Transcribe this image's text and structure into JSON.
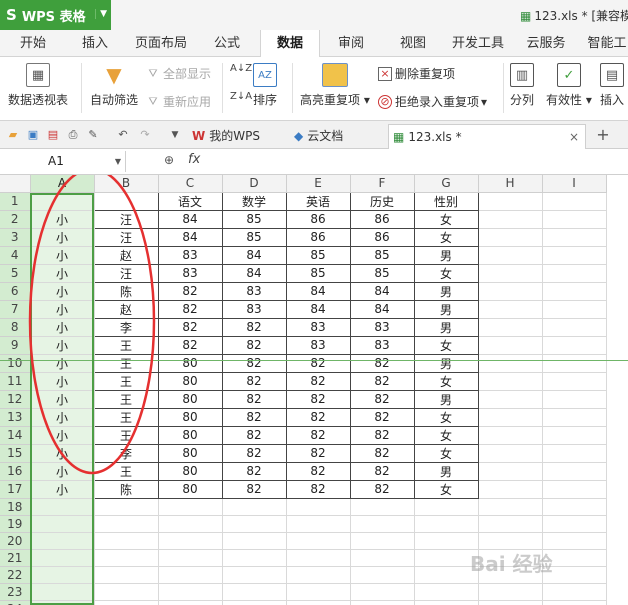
{
  "titlebar": {
    "app_name": "WPS 表格",
    "doc_title": "123.xls * [兼容模"
  },
  "menu": {
    "tabs": [
      "开始",
      "插入",
      "页面布局",
      "公式",
      "数据",
      "审阅",
      "视图",
      "开发工具",
      "云服务",
      "智能工"
    ],
    "active": "数据"
  },
  "ribbon": {
    "pivot": "数据透视表",
    "autofilter": "自动筛选",
    "show_all": "全部显示",
    "reapply": "重新应用",
    "sort": "排序",
    "highlight_dup": "高亮重复项",
    "remove_dup": "删除重复项",
    "reject_dup": "拒绝录入重复项",
    "split": "分列",
    "validity": "有效性",
    "insert": "插入"
  },
  "tabstrip": {
    "tabs": [
      {
        "label": "我的WPS"
      },
      {
        "label": "云文档"
      },
      {
        "label": "123.xls *"
      }
    ]
  },
  "formula": {
    "cell": "A1",
    "fx": "fx"
  },
  "grid": {
    "columns": [
      "A",
      "B",
      "C",
      "D",
      "E",
      "F",
      "G",
      "H",
      "I"
    ],
    "header_row": [
      "",
      "",
      "语文",
      "数学",
      "英语",
      "历史",
      "性别"
    ],
    "rows": [
      [
        "小",
        "汪",
        "84",
        "85",
        "86",
        "86",
        "女"
      ],
      [
        "小",
        "汪",
        "84",
        "85",
        "86",
        "86",
        "女"
      ],
      [
        "小",
        "赵",
        "83",
        "84",
        "85",
        "85",
        "男"
      ],
      [
        "小",
        "汪",
        "83",
        "84",
        "85",
        "85",
        "女"
      ],
      [
        "小",
        "陈",
        "82",
        "83",
        "84",
        "84",
        "男"
      ],
      [
        "小",
        "赵",
        "82",
        "83",
        "84",
        "84",
        "男"
      ],
      [
        "小",
        "李",
        "82",
        "82",
        "83",
        "83",
        "男"
      ],
      [
        "小",
        "王",
        "82",
        "82",
        "83",
        "83",
        "女"
      ],
      [
        "小",
        "王",
        "80",
        "82",
        "82",
        "82",
        "男"
      ],
      [
        "小",
        "王",
        "80",
        "82",
        "82",
        "82",
        "女"
      ],
      [
        "小",
        "王",
        "80",
        "82",
        "82",
        "82",
        "男"
      ],
      [
        "小",
        "王",
        "80",
        "82",
        "82",
        "82",
        "女"
      ],
      [
        "小",
        "王",
        "80",
        "82",
        "82",
        "82",
        "女"
      ],
      [
        "小",
        "李",
        "80",
        "82",
        "82",
        "82",
        "女"
      ],
      [
        "小",
        "王",
        "80",
        "82",
        "82",
        "82",
        "男"
      ],
      [
        "小",
        "陈",
        "80",
        "82",
        "82",
        "82",
        "女"
      ]
    ],
    "total_rows": 25
  },
  "watermark": "Bai 经验",
  "colors": {
    "accent": "#3f9f3c",
    "selection": "#d3ecd0",
    "annotation": "#e53030"
  }
}
